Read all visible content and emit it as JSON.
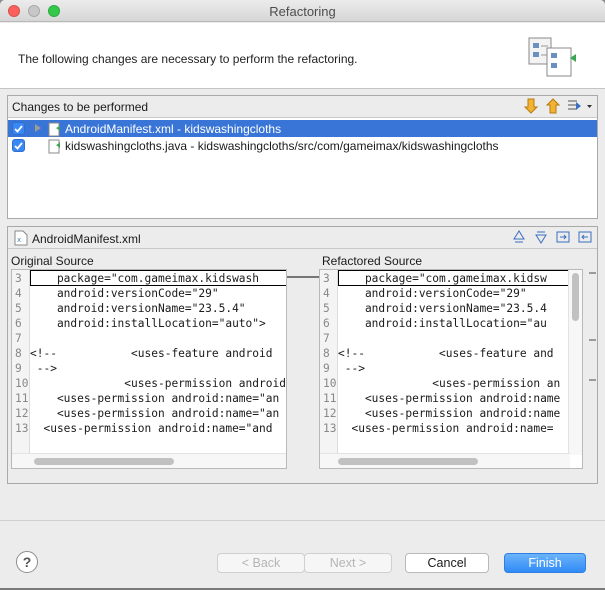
{
  "window": {
    "title": "Refactoring"
  },
  "header": {
    "message": "The following changes are necessary to perform the refactoring.",
    "icon": "refactor-wizard-icon"
  },
  "changes": {
    "label": "Changes to be performed",
    "items": [
      {
        "label": "AndroidManifest.xml - kidswashingcloths",
        "checked": true,
        "selected": true,
        "expandable": true,
        "icon": "xml-change-icon"
      },
      {
        "label": "kidswashingcloths.java - kidswashingcloths/src/com/gameimax/kidswashingcloths",
        "checked": true,
        "selected": false,
        "expandable": false,
        "icon": "java-change-icon"
      }
    ]
  },
  "compare": {
    "file_label": "AndroidManifest.xml",
    "original": {
      "title": "Original Source",
      "lines": [
        {
          "n": "3",
          "text": "    package=\"com.gameimax.kidswash"
        },
        {
          "n": "4",
          "text": "    android:versionCode=\"29\""
        },
        {
          "n": "5",
          "text": "    android:versionName=\"23.5.4\""
        },
        {
          "n": "6",
          "text": "    android:installLocation=\"auto\">"
        },
        {
          "n": "7",
          "text": ""
        },
        {
          "n": "8",
          "text": "<!--           <uses-feature android"
        },
        {
          "n": "9",
          "text": " -->"
        },
        {
          "n": "10",
          "text": "              <uses-permission android"
        },
        {
          "n": "11",
          "text": "    <uses-permission android:name=\"an"
        },
        {
          "n": "12",
          "text": "    <uses-permission android:name=\"an"
        },
        {
          "n": "13",
          "text": "  <uses-permission android:name=\"and"
        }
      ]
    },
    "refactored": {
      "title": "Refactored Source",
      "lines": [
        {
          "n": "3",
          "text": "    package=\"com.gameimax.kidsw"
        },
        {
          "n": "4",
          "text": "    android:versionCode=\"29\""
        },
        {
          "n": "5",
          "text": "    android:versionName=\"23.5.4"
        },
        {
          "n": "6",
          "text": "    android:installLocation=\"au"
        },
        {
          "n": "7",
          "text": ""
        },
        {
          "n": "8",
          "text": "<!--           <uses-feature and"
        },
        {
          "n": "9",
          "text": " -->"
        },
        {
          "n": "10",
          "text": "              <uses-permission an"
        },
        {
          "n": "11",
          "text": "    <uses-permission android:name"
        },
        {
          "n": "12",
          "text": "    <uses-permission android:name"
        },
        {
          "n": "13",
          "text": "  <uses-permission android:name="
        }
      ]
    }
  },
  "buttons": {
    "help": "?",
    "back": "< Back",
    "next": "Next >",
    "cancel": "Cancel",
    "finish": "Finish"
  }
}
